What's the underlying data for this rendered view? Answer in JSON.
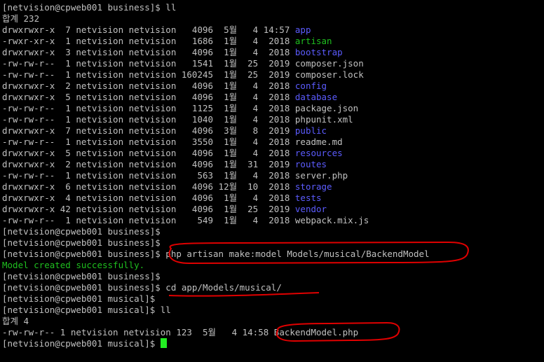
{
  "prompt_business": "[netvision@cpweb001 business]$ ",
  "prompt_musical": "[netvision@cpweb001 musical]$ ",
  "cmd_ll": "ll",
  "total_line_1": "합계 232",
  "listing": [
    {
      "meta": "drwxrwxr-x  7 netvision netvision   4096  5월   4 14:57 ",
      "name": "app",
      "kind": "dir"
    },
    {
      "meta": "-rwxr-xr-x  1 netvision netvision   1686  1월   4  2018 ",
      "name": "artisan",
      "kind": "exe"
    },
    {
      "meta": "drwxrwxr-x  3 netvision netvision   4096  1월   4  2018 ",
      "name": "bootstrap",
      "kind": "dir"
    },
    {
      "meta": "-rw-rw-r--  1 netvision netvision   1541  1월  25  2019 ",
      "name": "composer.json",
      "kind": "file"
    },
    {
      "meta": "-rw-rw-r--  1 netvision netvision 160245  1월  25  2019 ",
      "name": "composer.lock",
      "kind": "file"
    },
    {
      "meta": "drwxrwxr-x  2 netvision netvision   4096  1월   4  2018 ",
      "name": "config",
      "kind": "dir"
    },
    {
      "meta": "drwxrwxr-x  5 netvision netvision   4096  1월   4  2018 ",
      "name": "database",
      "kind": "dir"
    },
    {
      "meta": "-rw-rw-r--  1 netvision netvision   1125  1월   4  2018 ",
      "name": "package.json",
      "kind": "file"
    },
    {
      "meta": "-rw-rw-r--  1 netvision netvision   1040  1월   4  2018 ",
      "name": "phpunit.xml",
      "kind": "file"
    },
    {
      "meta": "drwxrwxr-x  7 netvision netvision   4096  3월   8  2019 ",
      "name": "public",
      "kind": "dir"
    },
    {
      "meta": "-rw-rw-r--  1 netvision netvision   3550  1월   4  2018 ",
      "name": "readme.md",
      "kind": "file"
    },
    {
      "meta": "drwxrwxr-x  5 netvision netvision   4096  1월   4  2018 ",
      "name": "resources",
      "kind": "dir"
    },
    {
      "meta": "drwxrwxr-x  2 netvision netvision   4096  1월  31  2019 ",
      "name": "routes",
      "kind": "dir"
    },
    {
      "meta": "-rw-rw-r--  1 netvision netvision    563  1월   4  2018 ",
      "name": "server.php",
      "kind": "file"
    },
    {
      "meta": "drwxrwxr-x  6 netvision netvision   4096 12월  10  2018 ",
      "name": "storage",
      "kind": "dir"
    },
    {
      "meta": "drwxrwxr-x  4 netvision netvision   4096  1월   4  2018 ",
      "name": "tests",
      "kind": "dir"
    },
    {
      "meta": "drwxrwxr-x 42 netvision netvision   4096  1월  25  2019 ",
      "name": "vendor",
      "kind": "dir"
    },
    {
      "meta": "-rw-rw-r--  1 netvision netvision    549  1월   4  2018 ",
      "name": "webpack.mix.js",
      "kind": "file"
    }
  ],
  "cmd_make_model": "php artisan make:model Models/musical/BackendModel",
  "success_message": "Model created successfully.",
  "cmd_cd": "cd app/Models/musical/",
  "total_line_2": "합계 4",
  "listing2": [
    {
      "meta": "-rw-rw-r-- 1 netvision netvision 123  5월   4 14:58 ",
      "name": "BackendModel.php",
      "kind": "file"
    }
  ],
  "colors": {
    "background": "#000000",
    "text": "#c0c0c0",
    "directory": "#5c5cff",
    "executable": "#1fbf1f",
    "success": "#1fbf1f",
    "cursor": "#22ee22",
    "annotation": "#e00000"
  }
}
